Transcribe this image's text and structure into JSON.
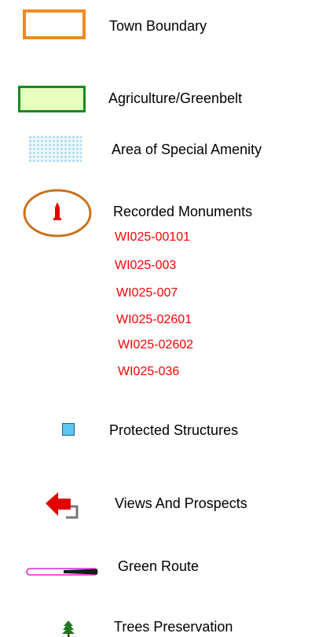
{
  "legend": {
    "town_boundary": "Town Boundary",
    "agriculture": "Agriculture/Greenbelt",
    "special_amenity": "Area of Special Amenity",
    "recorded_monuments": "Recorded Monuments",
    "monument_ids": [
      "WI025-00101",
      "WI025-003",
      "WI025-007",
      "WI025-02601",
      "WI025-02602",
      "WI025-036"
    ],
    "protected_structures": "Protected Structures",
    "views_prospects": "Views And Prospects",
    "green_route": "Green Route",
    "trees_preservation": "Trees Preservation"
  },
  "colors": {
    "town_boundary": "#f28a1e",
    "agriculture_border": "#138a20",
    "agriculture_fill": "#e6fdbd",
    "amenity_dots": "#9fd0ec",
    "monument_ring": "#c8731f",
    "monument_marker": "#e00000",
    "monument_text": "#ff0000",
    "protected_structure": "#5cc6f0",
    "views_arrow": "#e00000",
    "green_route_outline": "#e020d0",
    "tree": "#1e7a1e"
  },
  "icons": {
    "town_boundary": "orange-rectangle-outline",
    "agriculture": "green-filled-rectangle",
    "special_amenity": "dotted-hatch-rectangle",
    "recorded_monuments": "monument-marker-in-ring",
    "protected_structures": "blue-square",
    "views_prospects": "red-arrow-left",
    "green_route": "route-line",
    "trees_preservation": "tree-icon"
  }
}
